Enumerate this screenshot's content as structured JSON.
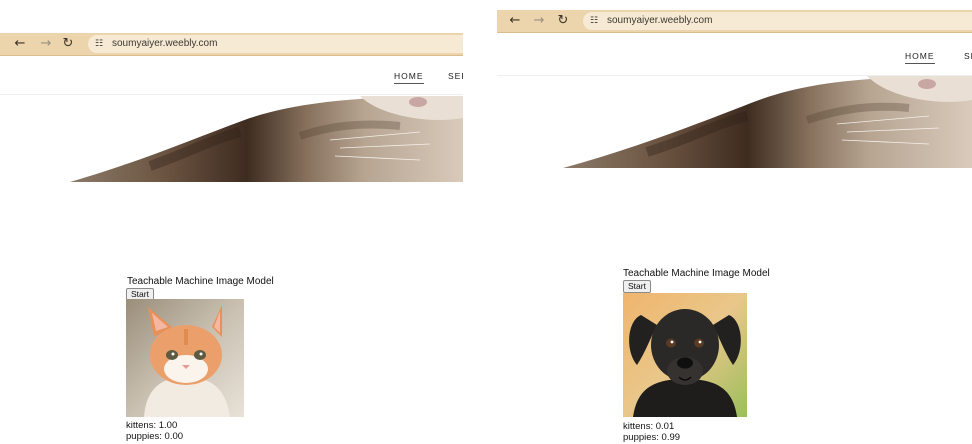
{
  "left": {
    "browser": {
      "back_icon": "back-arrow-icon",
      "forward_icon": "forward-arrow-icon",
      "reload_icon": "reload-icon",
      "url": "soumyaiyer.weebly.com"
    },
    "site_nav": {
      "items": [
        "HOME",
        "SER"
      ]
    },
    "model": {
      "title": "Teachable Machine Image Model",
      "start_label": "Start",
      "image_subject": "kitten",
      "predictions": [
        {
          "text": "kittens: 1.00"
        },
        {
          "text": "puppies: 0.00"
        }
      ]
    }
  },
  "right": {
    "browser": {
      "back_icon": "back-arrow-icon",
      "forward_icon": "forward-arrow-icon",
      "reload_icon": "reload-icon",
      "url": "soumyaiyer.weebly.com"
    },
    "site_nav": {
      "items": [
        "HOME",
        "SE"
      ]
    },
    "model": {
      "title": "Teachable Machine Image Model",
      "start_label": "Start",
      "image_subject": "puppy",
      "predictions": [
        {
          "text": "kittens: 0.01"
        },
        {
          "text": "puppies: 0.99"
        }
      ]
    }
  },
  "colors": {
    "address_bar": "#ecd4ad",
    "url_pill": "#f6ead4"
  }
}
